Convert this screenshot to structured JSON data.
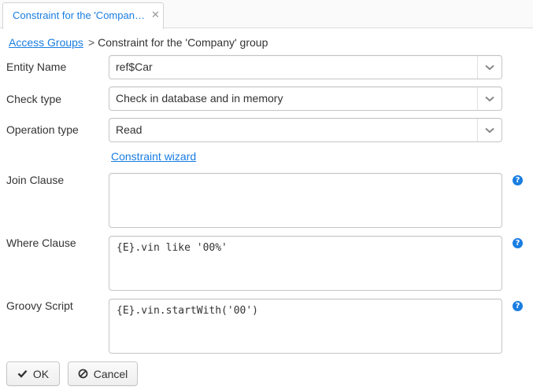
{
  "tab": {
    "title": "Constraint for the 'Company' group",
    "close_glyph": "✕"
  },
  "breadcrumb": {
    "link": "Access Groups",
    "separator": ">",
    "current": "Constraint for the 'Company' group"
  },
  "form": {
    "entity_name": {
      "label": "Entity Name",
      "value": "ref$Car"
    },
    "check_type": {
      "label": "Check type",
      "value": "Check in database and in memory"
    },
    "operation_type": {
      "label": "Operation type",
      "value": "Read"
    },
    "wizard_link": "Constraint wizard",
    "join_clause": {
      "label": "Join Clause",
      "value": ""
    },
    "where_clause": {
      "label": "Where Clause",
      "value": "{E}.vin like '00%'"
    },
    "groovy_script": {
      "label": "Groovy Script",
      "value": "{E}.vin.startWith('00')"
    },
    "help_glyph": "?"
  },
  "buttons": {
    "ok": "OK",
    "cancel": "Cancel"
  },
  "colors": {
    "accent": "#197de1",
    "ok_icon": "#333333"
  },
  "icons": {
    "dropdown": "chevron-down-icon",
    "help": "question-circle-icon",
    "ok": "check-icon",
    "cancel": "ban-icon"
  }
}
